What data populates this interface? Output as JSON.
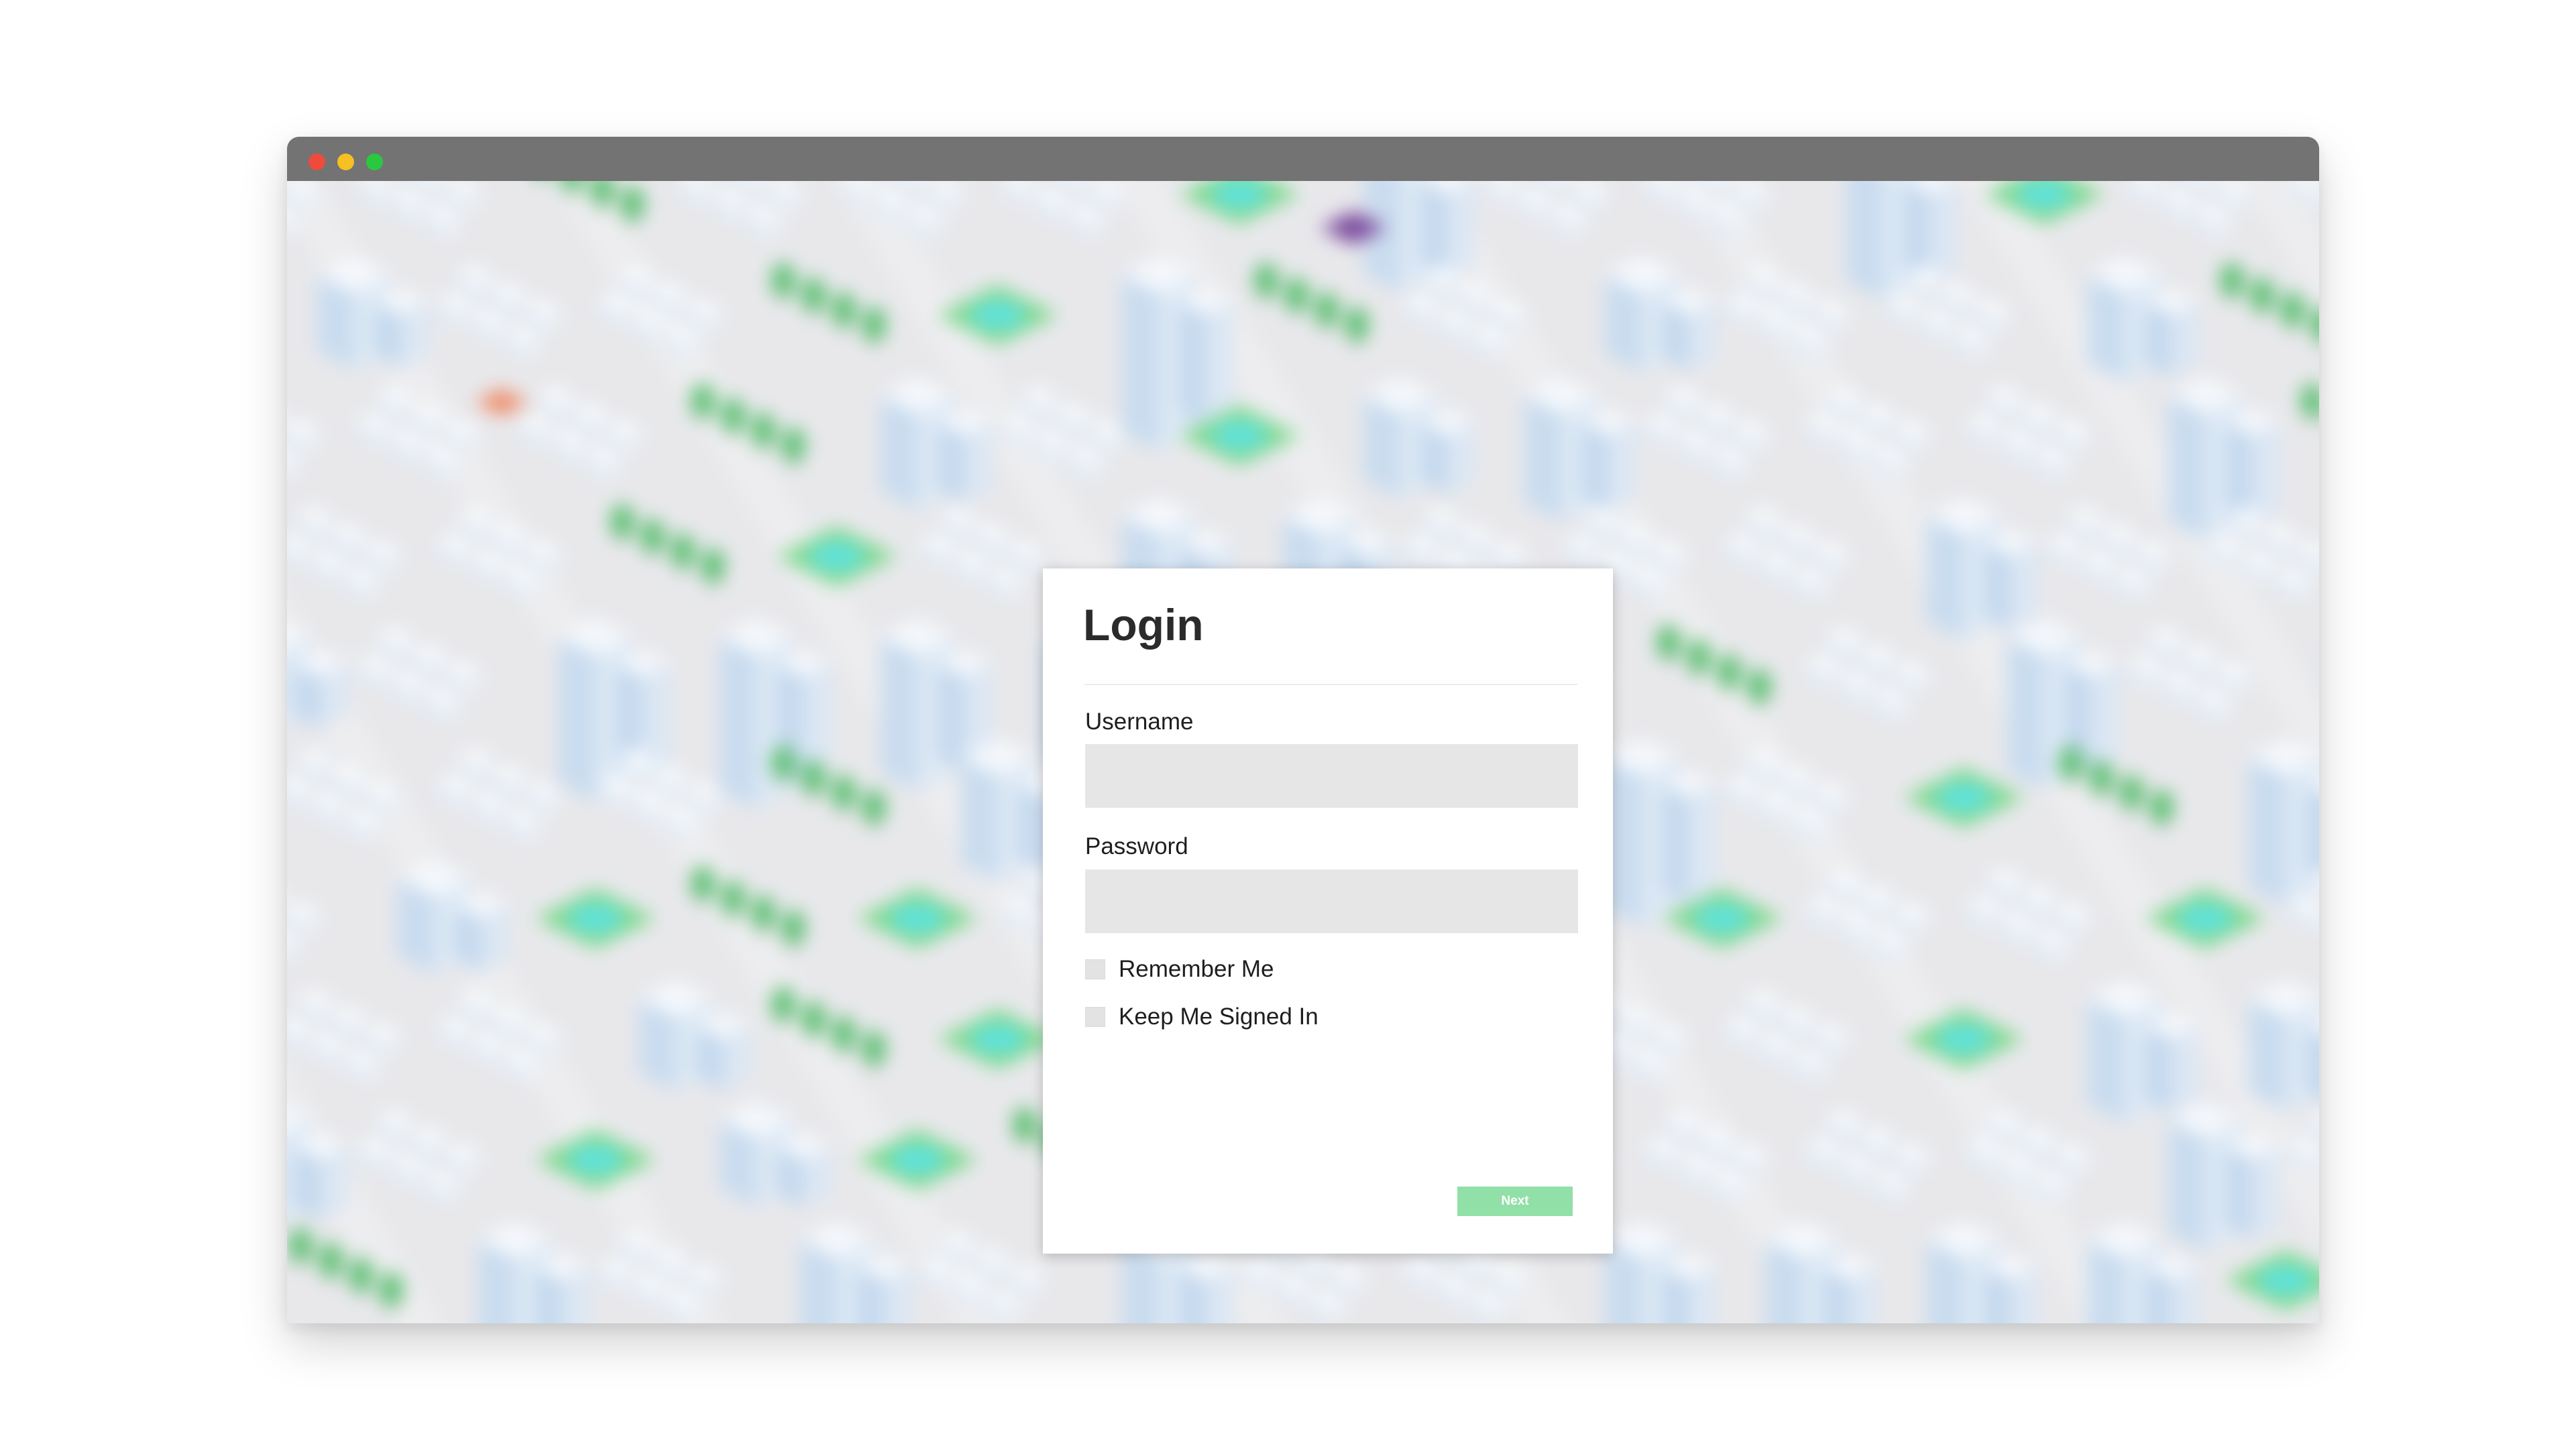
{
  "window": {
    "traffic_lights": {
      "close_color": "#ee4b3c",
      "minimize_color": "#f5c021",
      "maximize_color": "#2ac840"
    },
    "titlebar_color": "#737373"
  },
  "background": {
    "description_icon": "isometric-city-icon"
  },
  "login": {
    "title": "Login",
    "username": {
      "label": "Username",
      "value": "",
      "placeholder": ""
    },
    "password": {
      "label": "Password",
      "value": "",
      "placeholder": ""
    },
    "options": {
      "remember_me": "Remember Me",
      "keep_signed_in": "Keep Me Signed In"
    },
    "next_label": "Next"
  },
  "colors": {
    "accent": "#91e0a8",
    "input_bg": "#e6e6e7",
    "text": "#1e1e1e"
  }
}
